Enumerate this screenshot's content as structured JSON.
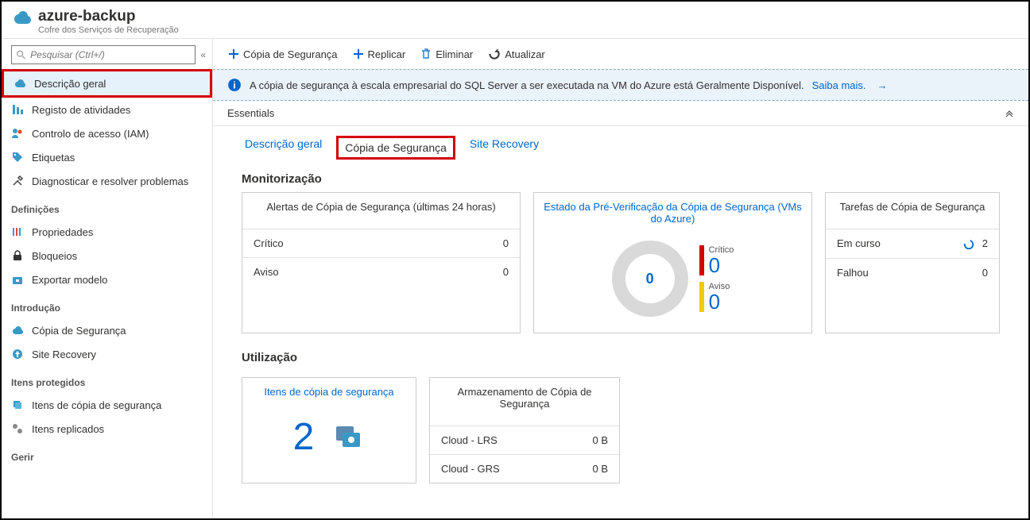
{
  "header": {
    "title": "azure-backup",
    "subtitle": "Cofre dos Serviços de Recuperação"
  },
  "sidebar": {
    "search_placeholder": "Pesquisar (Ctrl+/)",
    "items": [
      {
        "label": "Descrição geral"
      },
      {
        "label": "Registo de atividades"
      },
      {
        "label": "Controlo de acesso (IAM)"
      },
      {
        "label": "Etiquetas"
      },
      {
        "label": "Diagnosticar e resolver problemas"
      }
    ],
    "group_settings": "Definições",
    "settings_items": [
      {
        "label": "Propriedades"
      },
      {
        "label": "Bloqueios"
      },
      {
        "label": "Exportar modelo"
      }
    ],
    "group_intro": "Introdução",
    "intro_items": [
      {
        "label": "Cópia de Segurança"
      },
      {
        "label": "Site Recovery"
      }
    ],
    "group_protected": "Itens protegidos",
    "protected_items": [
      {
        "label": "Itens de cópia de segurança"
      },
      {
        "label": "Itens replicados"
      }
    ],
    "group_manage": "Gerir"
  },
  "toolbar": {
    "backup": "Cópia de Segurança",
    "replicate": "Replicar",
    "delete": "Eliminar",
    "refresh": "Atualizar"
  },
  "banner": {
    "text": "A cópia de segurança à escala empresarial do SQL Server a ser executada na VM do Azure está Geralmente Disponível.",
    "link": "Saiba mais."
  },
  "essentials": {
    "label": "Essentials"
  },
  "tabs": {
    "overview": "Descrição geral",
    "backup": "Cópia de Segurança",
    "site_recovery": "Site Recovery"
  },
  "monitoring": {
    "title": "Monitorização",
    "alerts": {
      "title": "Alertas de Cópia de Segurança (últimas 24 horas)",
      "critical_label": "Crítico",
      "critical_value": "0",
      "warning_label": "Aviso",
      "warning_value": "0"
    },
    "precheck": {
      "title": "Estado da Pré-Verificação da Cópia de Segurança (VMs do Azure)",
      "donut_value": "0",
      "critical_label": "Crítico",
      "critical_value": "0",
      "warning_label": "Aviso",
      "warning_value": "0"
    },
    "jobs": {
      "title": "Tarefas de Cópia de Segurança",
      "in_progress_label": "Em curso",
      "in_progress_value": "2",
      "failed_label": "Falhou",
      "failed_value": "0"
    }
  },
  "usage": {
    "title": "Utilização",
    "items": {
      "title": "Itens de cópia de segurança",
      "value": "2"
    },
    "storage": {
      "title": "Armazenamento de Cópia de Segurança",
      "lrs_label": "Cloud - LRS",
      "lrs_value": "0 B",
      "grs_label": "Cloud - GRS",
      "grs_value": "0 B"
    }
  }
}
